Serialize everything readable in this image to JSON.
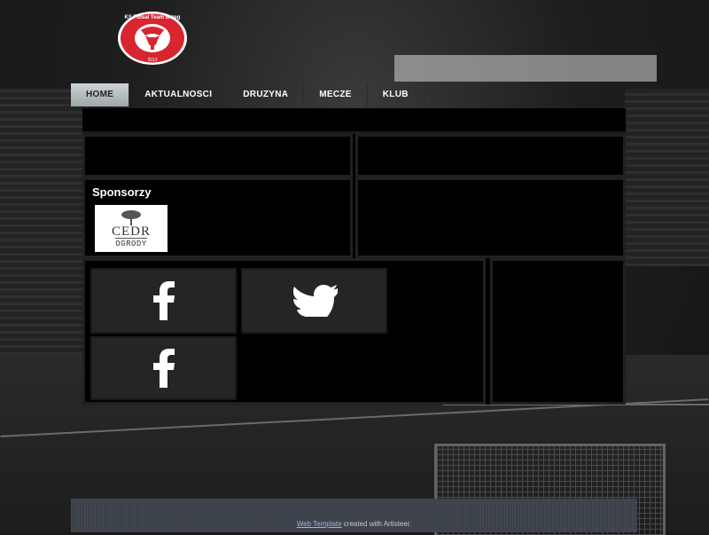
{
  "brand": {
    "logo_ring_text": "KS Futsal Team Brzeg",
    "logo_year": "2013"
  },
  "nav": {
    "items": [
      "HOME",
      "AKTUALNOSCI",
      "DRUZYNA",
      "MECZE",
      "KLUB"
    ],
    "active": "HOME"
  },
  "sidebar": {
    "sponsors_title": "Sponsorzy",
    "sponsor_logo_line1": "CEDR",
    "sponsor_logo_line2": "OGRODY"
  },
  "social": {
    "icons": [
      "facebook-icon",
      "twitter-icon",
      "facebook-icon"
    ]
  },
  "footer": {
    "link_text": "Web Template",
    "suffix_text": " created with Artisteer."
  },
  "colors": {
    "nav_active_bg": "#aeb6ba",
    "panel_bg": "#000000",
    "tile_bg": "#252525",
    "logo_red": "#d7262f"
  }
}
